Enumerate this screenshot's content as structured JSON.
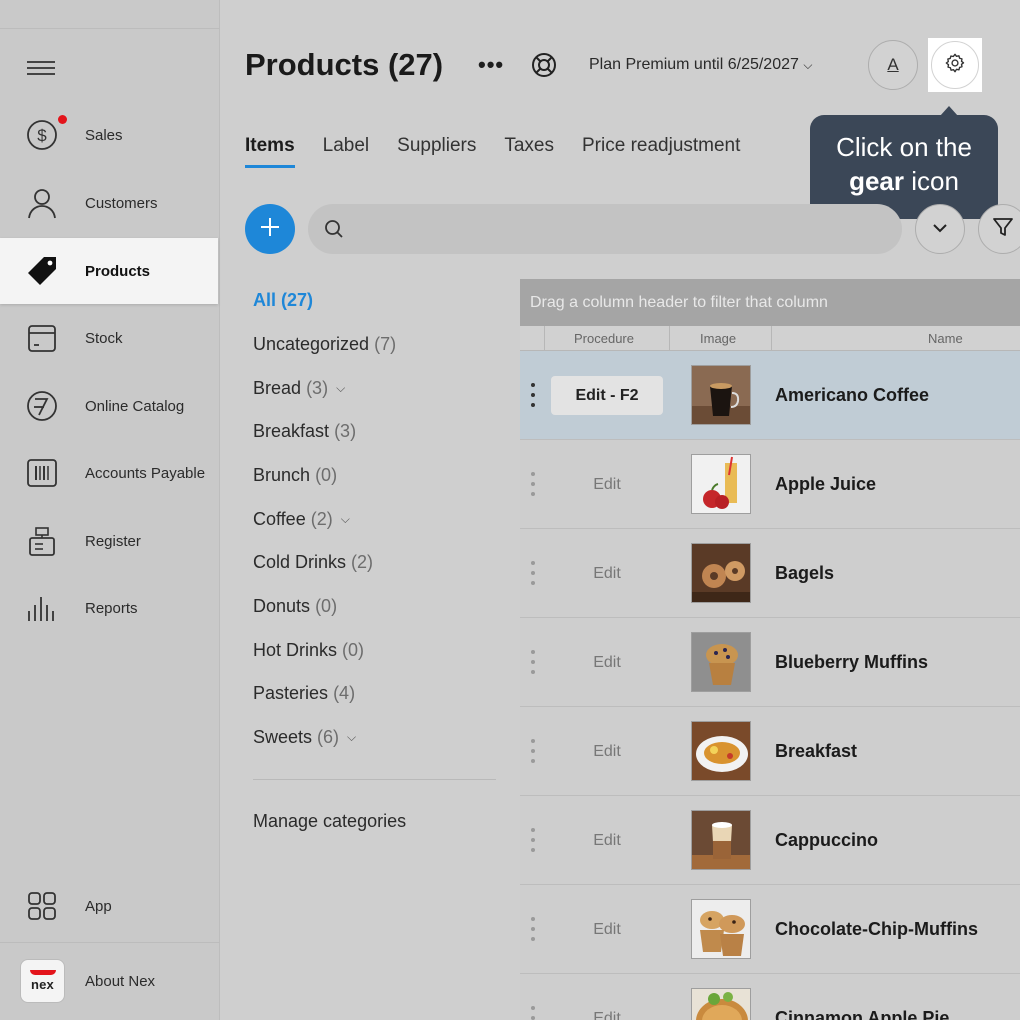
{
  "sidebar": {
    "items": [
      {
        "label": "Sales",
        "icon": "dollar-circle-icon"
      },
      {
        "label": "Customers",
        "icon": "user-icon"
      },
      {
        "label": "Products",
        "icon": "tag-icon"
      },
      {
        "label": "Stock",
        "icon": "box-icon"
      },
      {
        "label": "Online Catalog",
        "icon": "catalog-icon"
      },
      {
        "label": "Accounts Payable",
        "icon": "barcode-icon"
      },
      {
        "label": "Register",
        "icon": "register-icon"
      },
      {
        "label": "Reports",
        "icon": "bar-chart-icon"
      }
    ],
    "app_label": "App",
    "about_label": "About Nex",
    "logo_text": "nex"
  },
  "header": {
    "title": "Products (27)",
    "more": "•••",
    "plan": "Plan Premium until 6/25/2027",
    "a_button": "A"
  },
  "tabs": [
    "Items",
    "Label",
    "Suppliers",
    "Taxes",
    "Price readjustment"
  ],
  "tooltip": {
    "line1": "Click on the",
    "bold": "gear",
    "rest": " icon"
  },
  "search": {
    "placeholder": ""
  },
  "categories": [
    {
      "name": "All",
      "count": "(27)",
      "active": true,
      "caret": false
    },
    {
      "name": "Uncategorized",
      "count": "(7)",
      "caret": false
    },
    {
      "name": "Bread",
      "count": "(3)",
      "caret": true
    },
    {
      "name": "Breakfast",
      "count": "(3)",
      "caret": false
    },
    {
      "name": "Brunch",
      "count": "(0)",
      "caret": false
    },
    {
      "name": "Coffee",
      "count": "(2)",
      "caret": true
    },
    {
      "name": "Cold Drinks",
      "count": "(2)",
      "caret": false
    },
    {
      "name": "Donuts",
      "count": "(0)",
      "caret": false
    },
    {
      "name": "Hot Drinks",
      "count": "(0)",
      "caret": false
    },
    {
      "name": "Pasteries",
      "count": "(4)",
      "caret": false
    },
    {
      "name": "Sweets",
      "count": "(6)",
      "caret": true
    }
  ],
  "manage_categories": "Manage categories",
  "grid": {
    "drag_hint": "Drag a column header to filter that column",
    "columns": [
      "Procedure",
      "Image",
      "Name"
    ],
    "rows": [
      {
        "edit": "Edit - F2",
        "name": "Americano Coffee",
        "selected": true
      },
      {
        "edit": "Edit",
        "name": "Apple Juice"
      },
      {
        "edit": "Edit",
        "name": "Bagels"
      },
      {
        "edit": "Edit",
        "name": "Blueberry Muffins"
      },
      {
        "edit": "Edit",
        "name": "Breakfast"
      },
      {
        "edit": "Edit",
        "name": "Cappuccino"
      },
      {
        "edit": "Edit",
        "name": "Chocolate-Chip-Muffins"
      },
      {
        "edit": "Edit",
        "name": "Cinnamon Apple Pie"
      }
    ]
  },
  "colors": {
    "accent": "#1e87d8",
    "tooltip_bg": "#3b4757",
    "badge": "#e3141b"
  }
}
